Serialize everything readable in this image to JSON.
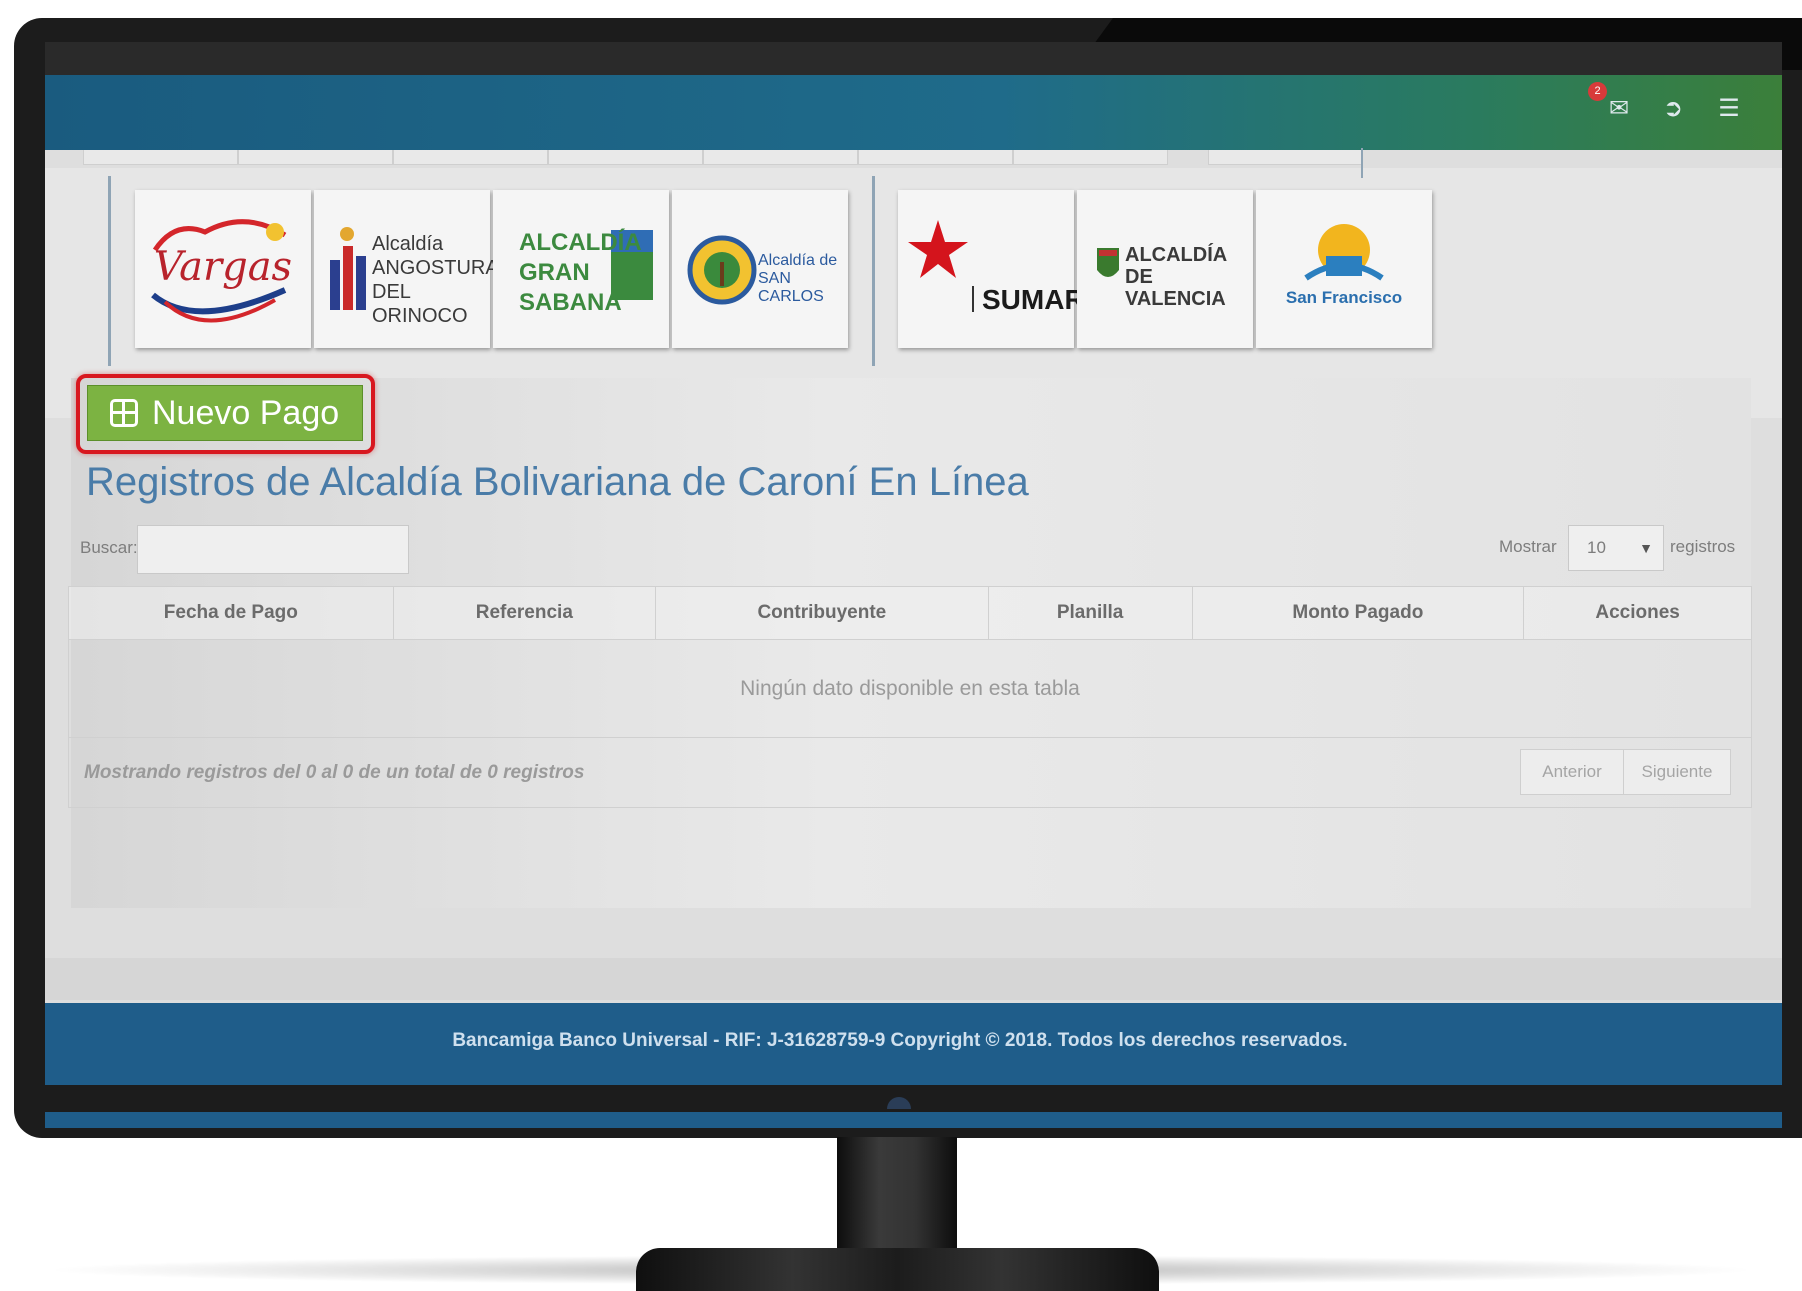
{
  "header": {
    "mail_badge": "2",
    "icons": [
      "mail-icon",
      "logout-icon",
      "menu-icon"
    ]
  },
  "logos": [
    {
      "text": "Vargas"
    },
    {
      "text": "Alcaldía ANGOSTURA DEL ORINOCO"
    },
    {
      "text": "ALCALDÍA GRAN SABANA"
    },
    {
      "text": "Alcaldía de SAN CARLOS"
    },
    {
      "text": "SUMAR"
    },
    {
      "text": "ALCALDÍA DE VALENCIA"
    },
    {
      "text": "San Francisco"
    }
  ],
  "main": {
    "new_payment_label": "Nuevo Pago",
    "title": "Registros de Alcaldía Bolivariana de Caroní En Línea",
    "search_label": "Buscar:",
    "show_label": "Mostrar",
    "page_size": "10",
    "records_label": "registros"
  },
  "table": {
    "columns": [
      "Fecha de Pago",
      "Referencia",
      "Contribuyente",
      "Planilla",
      "Monto Pagado",
      "Acciones"
    ],
    "empty_message": "Ningún dato disponible en esta tabla",
    "info": "Mostrando registros del 0 al 0 de un total de 0 registros",
    "prev_label": "Anterior",
    "next_label": "Siguiente"
  },
  "footer": {
    "text": "Bancamiga Banco Universal - RIF: J-31628759-9 Copyright © 2018. Todos los derechos reservados."
  },
  "colors": {
    "header_start": "#1a5b7f",
    "header_end": "#3b7f3a",
    "button_green": "#7cb342",
    "highlight_red": "#d8171f",
    "title_blue": "#4a7ca8",
    "footer_blue": "#1f5d8a"
  }
}
